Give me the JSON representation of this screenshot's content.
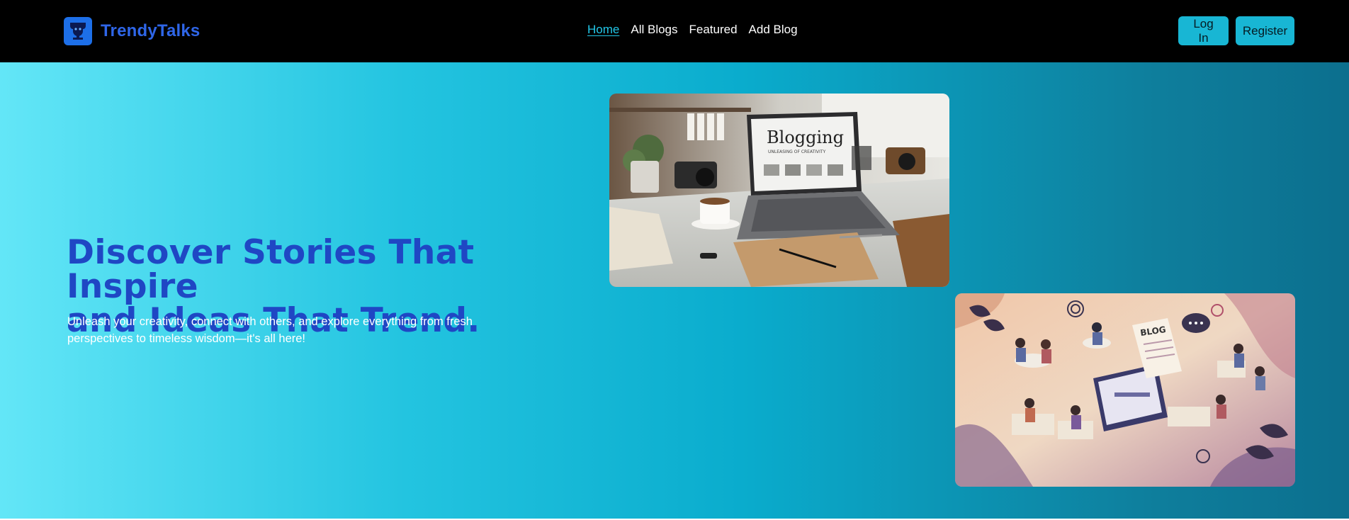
{
  "brand": {
    "name": "TrendyTalks",
    "logo_icon": "trophy-logo-icon"
  },
  "nav": {
    "items": [
      {
        "label": "Home",
        "active": true
      },
      {
        "label": "All Blogs",
        "active": false
      },
      {
        "label": "Featured",
        "active": false
      },
      {
        "label": "Add Blog",
        "active": false
      }
    ]
  },
  "auth": {
    "login_label": "Log In",
    "register_label": "Register"
  },
  "hero": {
    "title_line1": "Discover Stories That Inspire",
    "title_line2": "and Ideas That Trend.",
    "subtitle_line1": "Unleash your creativity, connect with others, and explore everything from fresh",
    "subtitle_line2": "perspectives to timeless wisdom—it's all here!",
    "image1_text": "Blogging",
    "image1_subtext": "UNLEASING OF CREATIVITY",
    "image2_text": "BLOG"
  },
  "colors": {
    "accent": "#18b6d4",
    "brand": "#2f66e8",
    "title": "#1f47c4",
    "active_link": "#22c7e8"
  }
}
